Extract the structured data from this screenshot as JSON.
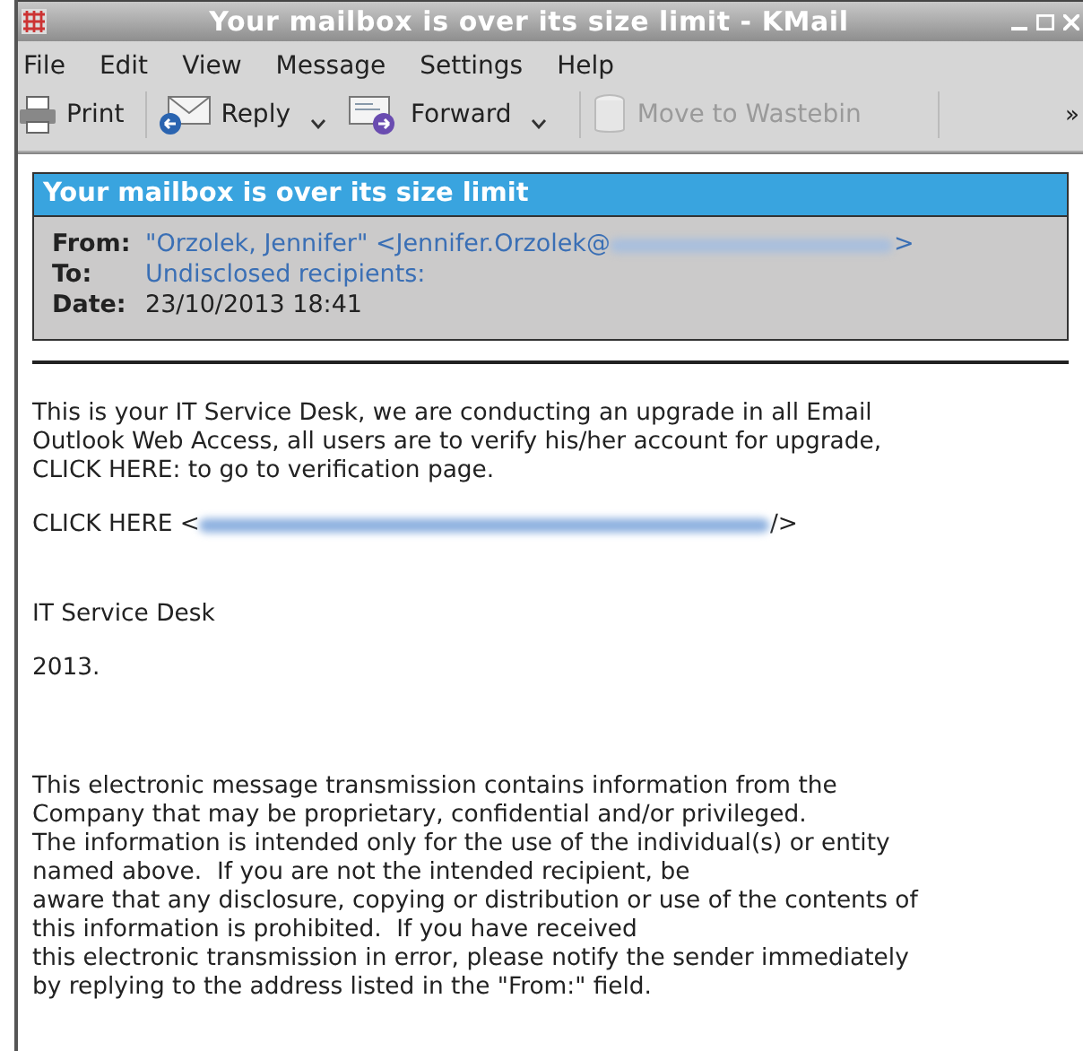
{
  "window": {
    "title": "Your mailbox is over its size limit - KMail"
  },
  "menu": [
    "File",
    "Edit",
    "View",
    "Message",
    "Settings",
    "Help"
  ],
  "toolbar": [
    {
      "kind": "print",
      "label": "Print",
      "dropdown": false,
      "disabled": false
    },
    {
      "kind": "reply",
      "label": "Reply",
      "dropdown": true,
      "disabled": false
    },
    {
      "kind": "forward",
      "label": "Forward",
      "dropdown": true,
      "disabled": false
    },
    {
      "kind": "trash",
      "label": "Move to Wastebin",
      "dropdown": false,
      "disabled": true
    }
  ],
  "toolbar_overflow": "»",
  "message": {
    "subject": "Your mailbox is over its size limit",
    "headers": [
      {
        "label": "From:",
        "value": "\"Orzolek, Jennifer\" <Jennifer.Orzolek@",
        "redacted": true,
        "tail": ">"
      },
      {
        "label": "To:",
        "value": "Undisclosed recipients:",
        "redacted": false
      },
      {
        "label": "Date:",
        "value": "23/10/2013 18:41",
        "redacted": false
      }
    ],
    "body": [
      {
        "kind": "text",
        "text": "This is your IT Service Desk, we are conducting an upgrade in all Email\nOutlook Web Access, all users are to verify his/her account for upgrade,\nCLICK HERE: to go to verification page."
      },
      {
        "kind": "link",
        "text": "CLICK HERE <",
        "tail": "/>"
      },
      {
        "kind": "text",
        "text": "IT Service Desk"
      },
      {
        "kind": "text",
        "text": "2013."
      },
      {
        "kind": "text",
        "text": "This electronic message transmission contains information from the\nCompany that may be proprietary, confidential and/or privileged.\nThe information is intended only for the use of the individual(s) or entity\nnamed above.  If you are not the intended recipient, be\naware that any disclosure, copying or distribution or use of the contents of\nthis information is prohibited.  If you have received\nthis electronic transmission in error, please notify the sender immediately\nby replying to the address listed in the \"From:\" field."
      }
    ]
  }
}
